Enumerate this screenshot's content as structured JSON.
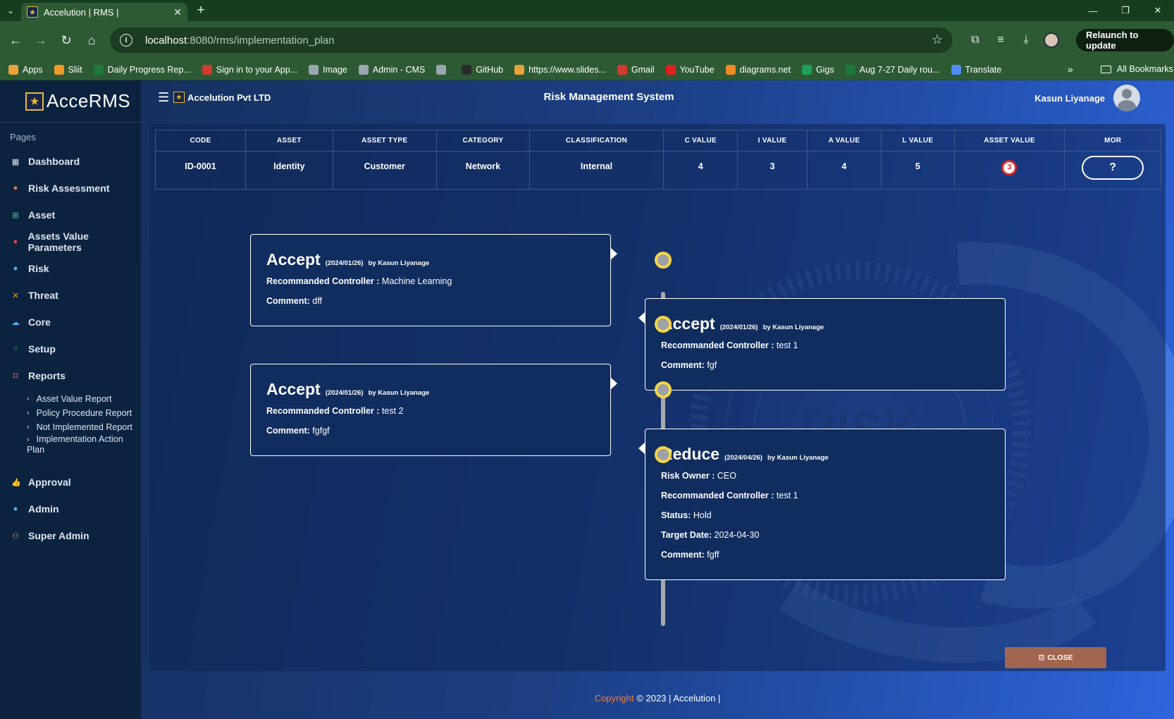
{
  "browser": {
    "tab_title": "Accelution | RMS |",
    "url_host": "localhost",
    "url_path": ":8080/rms/implementation_plan",
    "relaunch_label": "Relaunch to update",
    "bookmarks": [
      {
        "label": "Apps",
        "color": "#e8a33b"
      },
      {
        "label": "Sliit",
        "color": "#f09a2a"
      },
      {
        "label": "Daily Progress Rep...",
        "color": "#1d7a3d"
      },
      {
        "label": "Sign in to your App...",
        "color": "#d23b2f"
      },
      {
        "label": "Image",
        "color": "#9aa6b2"
      },
      {
        "label": "Admin - CMS",
        "color": "#9aa6b2"
      },
      {
        "label": "",
        "color": "#9aa6b2"
      },
      {
        "label": "GitHub",
        "color": "#2b2b2b"
      },
      {
        "label": "https://www.slides...",
        "color": "#e8a33b"
      },
      {
        "label": "Gmail",
        "color": "#d23b2f"
      },
      {
        "label": "YouTube",
        "color": "#e02020"
      },
      {
        "label": "diagrams.net",
        "color": "#f08a24"
      },
      {
        "label": "Gigs",
        "color": "#1ea05a"
      },
      {
        "label": "Aug 7-27 Daily rou...",
        "color": "#1d7a3d"
      },
      {
        "label": "Translate",
        "color": "#4c8df5"
      }
    ],
    "all_bookmarks": "All Bookmarks"
  },
  "sidebar": {
    "logo": "AcceRMS",
    "section": "Pages",
    "items": [
      {
        "label": "Dashboard",
        "icon": "▦",
        "color": "#dfe6ef"
      },
      {
        "label": "Risk Assessment",
        "icon": "●",
        "color": "#f07a3c"
      },
      {
        "label": "Asset",
        "icon": "⊞",
        "color": "#2fbf71"
      },
      {
        "label": "Assets Value Parameters",
        "icon": "●",
        "color": "#e84a4a"
      },
      {
        "label": "Risk",
        "icon": "●",
        "color": "#4fb3f6"
      },
      {
        "label": "Threat",
        "icon": "✕",
        "color": "#f0a02a"
      },
      {
        "label": "Core",
        "icon": "☁",
        "color": "#4fb3f6"
      },
      {
        "label": "Setup",
        "icon": "○",
        "color": "#2fbf71"
      },
      {
        "label": "Reports",
        "icon": "◘",
        "color": "#e84a4a"
      }
    ],
    "report_subitems": [
      "Asset Value Report",
      "Policy Procedure Report",
      "Not Implemented Report"
    ],
    "report_subitem_wrap": {
      "line1": "Implementation Action",
      "line2": "Plan"
    },
    "items_after": [
      {
        "label": "Approval",
        "icon": "👍",
        "color": "#2fbf71"
      },
      {
        "label": "Admin",
        "icon": "●",
        "color": "#4fb3f6"
      },
      {
        "label": "Super Admin",
        "icon": "⚇",
        "color": "#f0a02a"
      }
    ]
  },
  "header": {
    "company": "Accelution Pvt LTD",
    "title": "Risk Management System",
    "user": "Kasun Liyanage"
  },
  "asset_table": {
    "headers": [
      "CODE",
      "ASSET",
      "ASSET TYPE",
      "CATEGORY",
      "CLASSIFICATION",
      "C VALUE",
      "I VALUE",
      "A VALUE",
      "L VALUE",
      "ASSET VALUE",
      "MOR"
    ],
    "row": {
      "code": "ID-0001",
      "asset": "Identity",
      "asset_type": "Customer",
      "category": "Network",
      "classification": "Internal",
      "c_value": "4",
      "i_value": "3",
      "a_value": "4",
      "l_value": "5",
      "asset_value": "3",
      "mor": "?"
    }
  },
  "timeline": [
    {
      "action": "Accept",
      "date": "(2024/01/26)",
      "by": "by Kasun Liyanage",
      "rows": [
        {
          "k": "Recommanded Controller :",
          "v": "Machine Learning"
        },
        {
          "k": "Comment:",
          "v": "dff"
        }
      ]
    },
    {
      "action": "Accept",
      "date": "(2024/01/26)",
      "by": "by Kasun Liyanage",
      "rows": [
        {
          "k": "Recommanded Controller :",
          "v": "test 1"
        },
        {
          "k": "Comment:",
          "v": "fgf"
        }
      ]
    },
    {
      "action": "Accept",
      "date": "(2024/01/26)",
      "by": "by Kasun Liyanage",
      "rows": [
        {
          "k": "Recommanded Controller :",
          "v": "test 2"
        },
        {
          "k": "Comment:",
          "v": "fgfgf"
        }
      ]
    },
    {
      "action": "Reduce",
      "date": "(2024/04/26)",
      "by": "by Kasun Liyanage",
      "rows": [
        {
          "k": "Risk Owner :",
          "v": "CEO"
        },
        {
          "k": "Recommanded Controller :",
          "v": "test 1"
        },
        {
          "k": "Status:",
          "v": "Hold"
        },
        {
          "k": "Target Date:",
          "v": "2024-04-30"
        },
        {
          "k": "Comment:",
          "v": "fgff"
        }
      ]
    }
  ],
  "close_label": "CLOSE",
  "decor_text": "RISK",
  "footer": {
    "copyright": "Copyright",
    "rest": "© 2023 | Accelution |"
  }
}
